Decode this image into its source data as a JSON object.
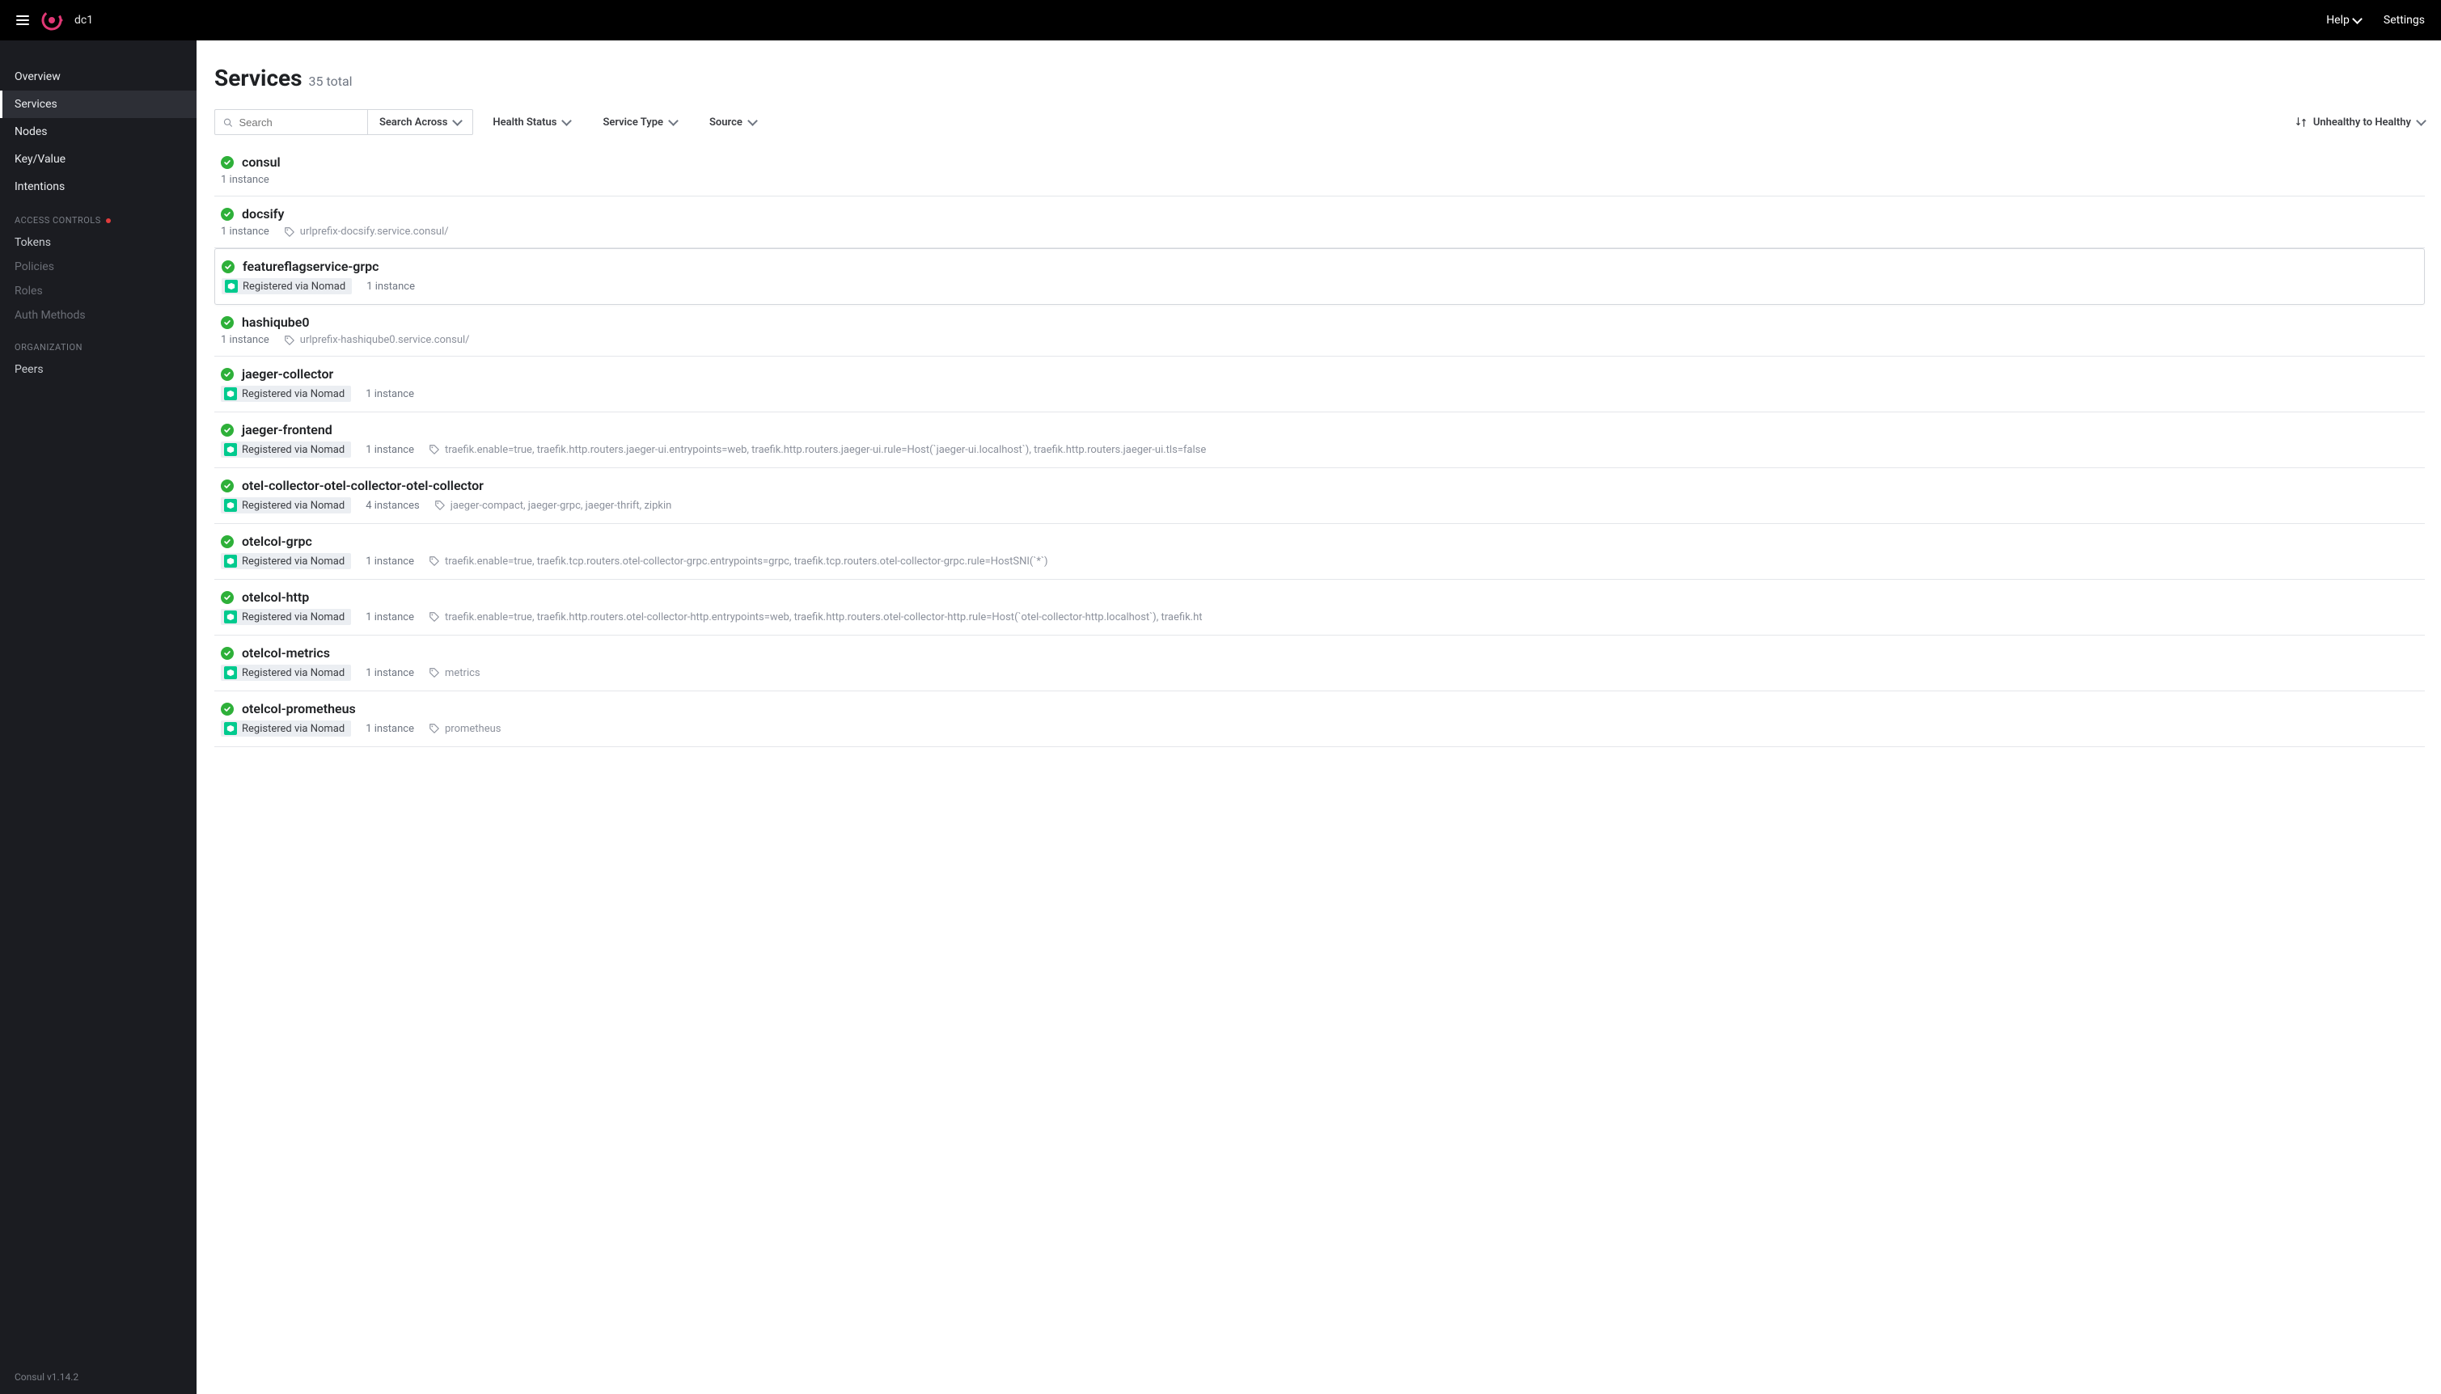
{
  "header": {
    "datacenter": "dc1",
    "help_label": "Help",
    "settings_label": "Settings"
  },
  "sidebar": {
    "nav": [
      {
        "label": "Overview",
        "active": false
      },
      {
        "label": "Services",
        "active": true
      },
      {
        "label": "Nodes",
        "active": false
      },
      {
        "label": "Key/Value",
        "active": false
      },
      {
        "label": "Intentions",
        "active": false
      }
    ],
    "access_section_label": "ACCESS CONTROLS",
    "access": [
      {
        "label": "Tokens",
        "disabled": false
      },
      {
        "label": "Policies",
        "disabled": true
      },
      {
        "label": "Roles",
        "disabled": true
      },
      {
        "label": "Auth Methods",
        "disabled": true
      }
    ],
    "org_section_label": "ORGANIZATION",
    "org": [
      {
        "label": "Peers"
      }
    ],
    "footer": "Consul v1.14.2"
  },
  "page": {
    "title": "Services",
    "count_label": "35 total"
  },
  "toolbar": {
    "search_placeholder": "Search",
    "search_across_label": "Search Across",
    "filters": {
      "health": "Health Status",
      "type": "Service Type",
      "source": "Source"
    },
    "sort_label": "Unhealthy to Healthy"
  },
  "registered_label": "Registered via Nomad",
  "services": [
    {
      "name": "consul",
      "instances": "1 instance",
      "nomad": false,
      "tags": null,
      "hovered": false
    },
    {
      "name": "docsify",
      "instances": "1 instance",
      "nomad": false,
      "tags": "urlprefix-docsify.service.consul/",
      "hovered": false
    },
    {
      "name": "featureflagservice-grpc",
      "instances": "1 instance",
      "nomad": true,
      "tags": null,
      "hovered": true
    },
    {
      "name": "hashiqube0",
      "instances": "1 instance",
      "nomad": false,
      "tags": "urlprefix-hashiqube0.service.consul/",
      "hovered": false
    },
    {
      "name": "jaeger-collector",
      "instances": "1 instance",
      "nomad": true,
      "tags": null,
      "hovered": false
    },
    {
      "name": "jaeger-frontend",
      "instances": "1 instance",
      "nomad": true,
      "tags": "traefik.enable=true, traefik.http.routers.jaeger-ui.entrypoints=web, traefik.http.routers.jaeger-ui.rule=Host(`jaeger-ui.localhost`), traefik.http.routers.jaeger-ui.tls=false",
      "hovered": false
    },
    {
      "name": "otel-collector-otel-collector-otel-collector",
      "instances": "4 instances",
      "nomad": true,
      "tags": "jaeger-compact, jaeger-grpc, jaeger-thrift, zipkin",
      "hovered": false
    },
    {
      "name": "otelcol-grpc",
      "instances": "1 instance",
      "nomad": true,
      "tags": "traefik.enable=true, traefik.tcp.routers.otel-collector-grpc.entrypoints=grpc, traefik.tcp.routers.otel-collector-grpc.rule=HostSNI(`*`)",
      "hovered": false
    },
    {
      "name": "otelcol-http",
      "instances": "1 instance",
      "nomad": true,
      "tags": "traefik.enable=true, traefik.http.routers.otel-collector-http.entrypoints=web, traefik.http.routers.otel-collector-http.rule=Host(`otel-collector-http.localhost`), traefik.ht",
      "hovered": false
    },
    {
      "name": "otelcol-metrics",
      "instances": "1 instance",
      "nomad": true,
      "tags": "metrics",
      "hovered": false
    },
    {
      "name": "otelcol-prometheus",
      "instances": "1 instance",
      "nomad": true,
      "tags": "prometheus",
      "hovered": false
    }
  ]
}
